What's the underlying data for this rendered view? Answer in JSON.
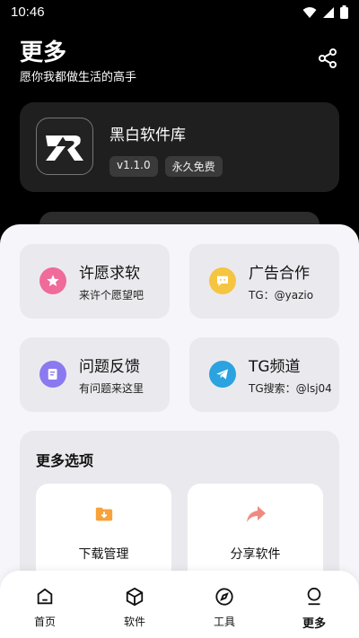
{
  "status_bar": {
    "time": "10:46"
  },
  "header": {
    "title": "更多",
    "subtitle": "愿你我都做生活的高手"
  },
  "app": {
    "name": "黑白软件库",
    "version": "v1.1.0",
    "price_tag": "永久免费"
  },
  "tiles": [
    {
      "title": "许愿求软",
      "subtitle": "来许个愿望吧",
      "icon": "star-icon",
      "color": "#f06a9a"
    },
    {
      "title": "广告合作",
      "subtitle": "TG：@yazio",
      "icon": "chat-bubble-icon",
      "color": "#f5c542"
    },
    {
      "title": "问题反馈",
      "subtitle": "有问题来这里",
      "icon": "feedback-icon",
      "color": "#8a7af0"
    },
    {
      "title": "TG频道",
      "subtitle": "TG搜索：@lsj04",
      "icon": "telegram-icon",
      "color": "#2aa3e0"
    }
  ],
  "more_options": {
    "title": "更多选项",
    "items": [
      {
        "label": "下载管理",
        "icon": "download-folder-icon",
        "color": "#f7a23b"
      },
      {
        "label": "分享软件",
        "icon": "share-arrow-icon",
        "color": "#f08a80"
      }
    ]
  },
  "tabbar": {
    "items": [
      {
        "label": "首页",
        "icon": "home-icon",
        "active": false
      },
      {
        "label": "软件",
        "icon": "cube-icon",
        "active": false
      },
      {
        "label": "工具",
        "icon": "compass-icon",
        "active": false
      },
      {
        "label": "更多",
        "icon": "profile-icon",
        "active": true
      }
    ]
  }
}
